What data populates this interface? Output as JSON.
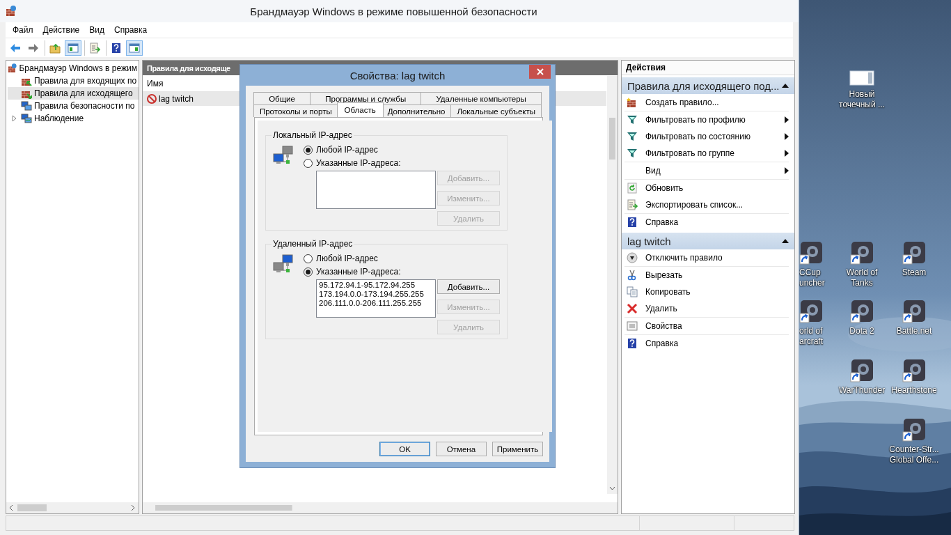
{
  "window": {
    "title": "Брандмауэр Windows в режиме повышенной безопасности"
  },
  "menu": [
    "Файл",
    "Действие",
    "Вид",
    "Справка"
  ],
  "toolbar": [
    [
      {
        "kind": "back",
        "pressed": false
      },
      {
        "kind": "forward",
        "pressed": false
      }
    ],
    [
      {
        "kind": "folder-up",
        "pressed": false
      },
      {
        "kind": "tree-pane",
        "pressed": true
      }
    ],
    [
      {
        "kind": "export",
        "pressed": false
      }
    ],
    [
      {
        "kind": "help",
        "pressed": false
      },
      {
        "kind": "action-pane",
        "pressed": true
      }
    ]
  ],
  "tree": {
    "label": "Брандмауэр Windows в режим",
    "kind": "firewall",
    "children": [
      {
        "label": "Правила для входящих по",
        "kind": "inbound",
        "selected": false
      },
      {
        "label": "Правила для исходящего",
        "kind": "outbound",
        "selected": true
      },
      {
        "label": "Правила безопасности по",
        "kind": "security",
        "selected": false
      },
      {
        "label": "Наблюдение",
        "kind": "monitor",
        "selected": false,
        "expanded": false
      }
    ]
  },
  "rules_pane": {
    "title": "Правила для исходяще",
    "columns": [
      "Имя"
    ],
    "rows": [
      {
        "name": "lag twitch",
        "kind": "blocked",
        "selected": true
      }
    ]
  },
  "actions": {
    "title": "Действия",
    "sections": [
      {
        "title": "Правила для исходящего под...",
        "expanded": true,
        "groups": [
          [
            {
              "label": "Создать правило...",
              "kind": "new-rule",
              "submenu": false
            }
          ],
          [
            {
              "label": "Фильтровать по профилю",
              "kind": "filter",
              "submenu": true
            },
            {
              "label": "Фильтровать по состоянию",
              "kind": "filter",
              "submenu": true
            },
            {
              "label": "Фильтровать по группе",
              "kind": "filter",
              "submenu": true
            }
          ],
          [
            {
              "label": "Вид",
              "kind": "none",
              "submenu": true
            }
          ],
          [
            {
              "label": "Обновить",
              "kind": "refresh",
              "submenu": false
            },
            {
              "label": "Экспортировать список...",
              "kind": "export",
              "submenu": false
            }
          ],
          [
            {
              "label": "Справка",
              "kind": "help",
              "submenu": false
            }
          ]
        ]
      },
      {
        "title": "lag twitch",
        "expanded": true,
        "groups": [
          [
            {
              "label": "Отключить правило",
              "kind": "disable",
              "submenu": false
            }
          ],
          [
            {
              "label": "Вырезать",
              "kind": "cut",
              "submenu": false
            },
            {
              "label": "Копировать",
              "kind": "copy",
              "submenu": false
            },
            {
              "label": "Удалить",
              "kind": "delete",
              "submenu": false
            }
          ],
          [
            {
              "label": "Свойства",
              "kind": "properties",
              "submenu": false
            }
          ],
          [
            {
              "label": "Справка",
              "kind": "help",
              "submenu": false
            }
          ]
        ]
      }
    ]
  },
  "dialog": {
    "title": "Свойства: lag twitch",
    "tab_rows": [
      [
        {
          "label": "Общие",
          "selected": false
        },
        {
          "label": "Программы и службы",
          "selected": false
        },
        {
          "label": "Удаленные компьютеры",
          "selected": false
        }
      ],
      [
        {
          "label": "Протоколы и порты",
          "selected": false
        },
        {
          "label": "Область",
          "selected": true
        },
        {
          "label": "Дополнительно",
          "selected": false
        },
        {
          "label": "Локальные субъекты",
          "selected": false
        }
      ]
    ],
    "groups": [
      {
        "title": "Локальный IP-адрес",
        "kind": "local",
        "options": [
          {
            "label": "Любой IP-адрес",
            "selected": true
          },
          {
            "label": "Указанные IP-адреса:",
            "selected": false
          }
        ],
        "buttons": [
          {
            "label": "Добавить...",
            "disabled": true
          },
          {
            "label": "Изменить...",
            "disabled": true
          },
          {
            "label": "Удалить",
            "disabled": true
          }
        ]
      },
      {
        "title": "Удаленный IP-адрес",
        "kind": "remote",
        "options": [
          {
            "label": "Любой IP-адрес",
            "selected": false
          },
          {
            "label": "Указанные IP-адреса:",
            "selected": true
          }
        ],
        "addresses": [
          "95.172.94.1-95.172.94.255",
          "173.194.0.0-173.194.255.255",
          "206.111.0.0-206.111.255.255"
        ],
        "buttons": [
          {
            "label": "Добавить...",
            "disabled": false
          },
          {
            "label": "Изменить...",
            "disabled": true
          },
          {
            "label": "Удалить",
            "disabled": true
          }
        ]
      }
    ],
    "buttons": [
      {
        "label": "OK",
        "default": true
      },
      {
        "label": "Отмена",
        "default": false
      },
      {
        "label": "Применить",
        "default": false
      }
    ]
  },
  "desktop": {
    "icons": [
      {
        "lines": [
          "Новый",
          "точечный ..."
        ],
        "kind": "file"
      },
      {
        "lines": [
          "CCup",
          "uncher"
        ],
        "kind": "app"
      },
      {
        "lines": [
          "World of",
          "Tanks"
        ],
        "kind": "app"
      },
      {
        "lines": [
          "Steam"
        ],
        "kind": "app"
      },
      {
        "lines": [
          "orld of",
          "arcraft"
        ],
        "kind": "app"
      },
      {
        "lines": [
          "Dota 2"
        ],
        "kind": "app"
      },
      {
        "lines": [
          "Battle.net"
        ],
        "kind": "app"
      },
      {
        "lines": [
          "WarThunder"
        ],
        "kind": "app"
      },
      {
        "lines": [
          "Hearthstone"
        ],
        "kind": "app"
      },
      {
        "lines": [
          "Counter-Str...",
          "Global Offe..."
        ],
        "kind": "app"
      }
    ]
  }
}
